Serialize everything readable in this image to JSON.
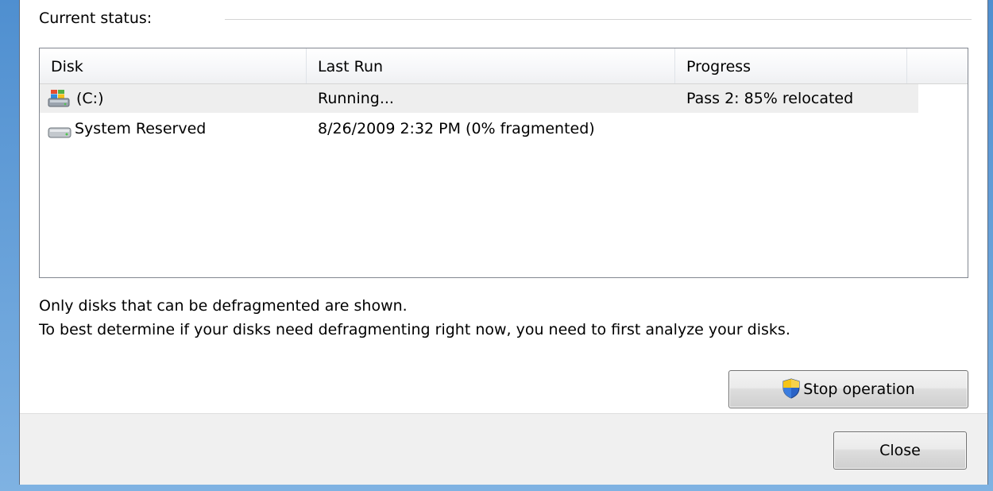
{
  "status": {
    "label": "Current status:"
  },
  "table": {
    "columns": [
      "Disk",
      "Last Run",
      "Progress"
    ],
    "rows": [
      {
        "icon": "windows-drive-icon",
        "disk": "(C:)",
        "last_run": "Running...",
        "progress": "Pass 2: 85% relocated",
        "selected": true
      },
      {
        "icon": "hard-drive-icon",
        "disk": "System Reserved",
        "last_run": "8/26/2009 2:32 PM (0% fragmented)",
        "progress": "",
        "selected": false
      }
    ]
  },
  "notes": {
    "line1": "Only disks that can be defragmented are shown.",
    "line2": "To best determine if your disks need defragmenting right now, you need to first analyze your disks."
  },
  "buttons": {
    "stop_icon": "uac-shield-icon",
    "stop_label": "Stop operation",
    "close_label": "Close"
  },
  "colors": {
    "frame_accent": "#4f8fd0",
    "selected_row": "#eeeeee",
    "footer_bg": "#f0f0f0"
  }
}
